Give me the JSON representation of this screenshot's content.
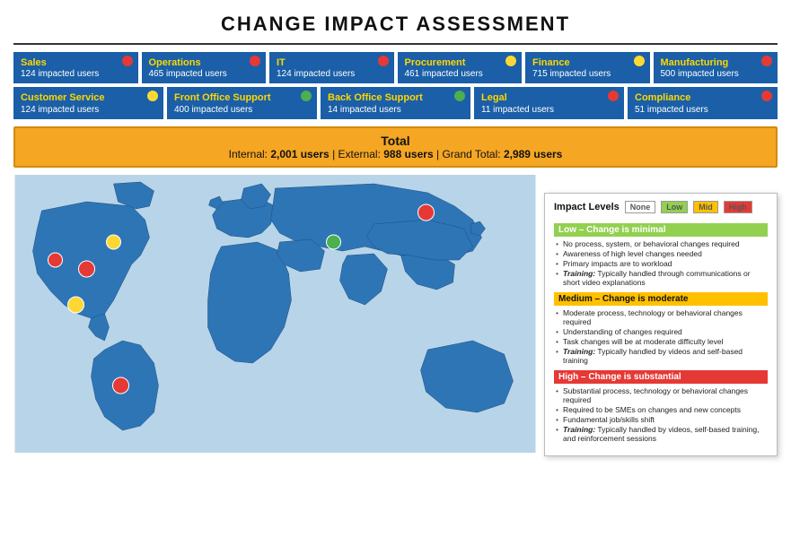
{
  "title": "CHANGE IMPACT ASSESSMENT",
  "departments_row1": [
    {
      "name": "Sales",
      "users": "124 impacted users",
      "dot": "red"
    },
    {
      "name": "Operations",
      "users": "465 impacted users",
      "dot": "red"
    },
    {
      "name": "IT",
      "users": "124 impacted users",
      "dot": "red"
    },
    {
      "name": "Procurement",
      "users": "461 impacted users",
      "dot": "yellow"
    },
    {
      "name": "Finance",
      "users": "715 impacted users",
      "dot": "yellow"
    },
    {
      "name": "Manufacturing",
      "users": "500 impacted users",
      "dot": "red"
    }
  ],
  "departments_row2": [
    {
      "name": "Customer Service",
      "users": "124 impacted users",
      "dot": "yellow"
    },
    {
      "name": "Front Office Support",
      "users": "400 impacted users",
      "dot": "green"
    },
    {
      "name": "Back Office Support",
      "users": "14 impacted users",
      "dot": "green"
    },
    {
      "name": "Legal",
      "users": "11 impacted users",
      "dot": "red"
    },
    {
      "name": "Compliance",
      "users": "51 impacted users",
      "dot": "red"
    }
  ],
  "total": {
    "label": "Total",
    "internal_label": "Internal:",
    "internal_value": "2,001 users",
    "separator1": "|",
    "external_label": "External:",
    "external_value": "988 users",
    "separator2": "|",
    "grand_label": "Grand Total:",
    "grand_value": "2,989 users"
  },
  "impact_legend": {
    "title": "Impact Levels",
    "levels": [
      "None",
      "Low",
      "Mid",
      "High"
    ],
    "sections": [
      {
        "header": "Low – Change is minimal",
        "color": "low",
        "bullets": [
          "No process, system, or behavioral changes required",
          "Awareness of high level changes needed",
          "Primary impacts are to workload",
          "Training: Typically handled through communications or short video explanations"
        ]
      },
      {
        "header": "Medium – Change is moderate",
        "color": "medium",
        "bullets": [
          "Moderate process, technology or behavioral changes required",
          "Understanding of changes required",
          "Task changes will be at moderate difficulty level",
          "Training: Typically handled by videos and self-based training"
        ]
      },
      {
        "header": "High – Change is substantial",
        "color": "high",
        "bullets": [
          "Substantial process, technology or behavioral changes required",
          "Required to be SMEs on changes and new concepts",
          "Fundamental job/skills shift",
          "Training: Typically handled by videos, self-based training, and reinforcement sessions"
        ]
      }
    ]
  },
  "map_dots": [
    {
      "left": "8%",
      "top": "28%",
      "size": 14,
      "color": "#e53935"
    },
    {
      "left": "12%",
      "top": "42%",
      "size": 16,
      "color": "#e53935"
    },
    {
      "left": "16%",
      "top": "52%",
      "size": 12,
      "color": "#fdd835"
    },
    {
      "left": "22%",
      "top": "75%",
      "size": 16,
      "color": "#e53935"
    },
    {
      "left": "24%",
      "top": "32%",
      "size": 14,
      "color": "#fdd835"
    },
    {
      "left": "52%",
      "top": "38%",
      "size": 14,
      "color": "#4caf50"
    },
    {
      "left": "62%",
      "top": "22%",
      "size": 16,
      "color": "#e53935"
    }
  ]
}
